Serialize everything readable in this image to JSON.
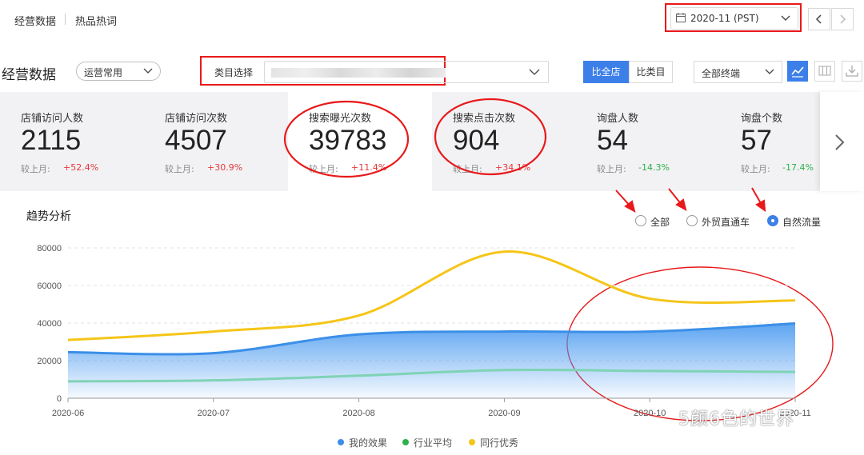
{
  "nav": {
    "tabs": [
      "经营数据",
      "热品热词"
    ],
    "date": "2020-11 (PST)"
  },
  "filters": {
    "page_title": "经营数据",
    "preset": "运营常用",
    "category_label": "类目选择",
    "compare": [
      "比全店",
      "比类目"
    ],
    "terminal": "全部终端"
  },
  "metrics": [
    {
      "label": "店铺访问人数",
      "value": "2115",
      "compare_label": "较上月:",
      "change": "+52.4%",
      "trend": "up"
    },
    {
      "label": "店铺访问次数",
      "value": "4507",
      "compare_label": "较上月:",
      "change": "+30.9%",
      "trend": "up"
    },
    {
      "label": "搜索曝光次数",
      "value": "39783",
      "compare_label": "较上月:",
      "change": "+11.4%",
      "trend": "up"
    },
    {
      "label": "搜索点击次数",
      "value": "904",
      "compare_label": "较上月:",
      "change": "+34.1%",
      "trend": "up"
    },
    {
      "label": "询盘人数",
      "value": "54",
      "compare_label": "较上月:",
      "change": "-14.3%",
      "trend": "down"
    },
    {
      "label": "询盘个数",
      "value": "57",
      "compare_label": "较上月:",
      "change": "-17.4%",
      "trend": "down"
    }
  ],
  "trend": {
    "title": "趋势分析",
    "radios": [
      {
        "label": "全部",
        "checked": false
      },
      {
        "label": "外贸直通车",
        "checked": false
      },
      {
        "label": "自然流量",
        "checked": true
      }
    ]
  },
  "chart_data": {
    "type": "line",
    "x": [
      "2020-06",
      "2020-07",
      "2020-08",
      "2020-09",
      "2020-10",
      "2020-11"
    ],
    "ylim": [
      0,
      80000
    ],
    "yticks": [
      "80000",
      "60000",
      "40000",
      "20000",
      "0"
    ],
    "series": [
      {
        "name": "我的效果",
        "color": "#3b8fe8",
        "values": [
          24500,
          24000,
          34000,
          35500,
          35500,
          39783
        ],
        "area": true
      },
      {
        "name": "行业平均",
        "color": "#7fd3b5",
        "values": [
          9000,
          9500,
          12000,
          15000,
          14500,
          14000
        ]
      },
      {
        "name": "同行优秀",
        "color": "#f5c518",
        "values": [
          31000,
          35500,
          44000,
          78000,
          53000,
          52000
        ]
      }
    ]
  },
  "watermark": "5颜6色的世界",
  "colors": {
    "accent": "#3d7fe8",
    "highlight": "#e8191a",
    "up": "#e4393c",
    "down": "#2cb14a"
  }
}
